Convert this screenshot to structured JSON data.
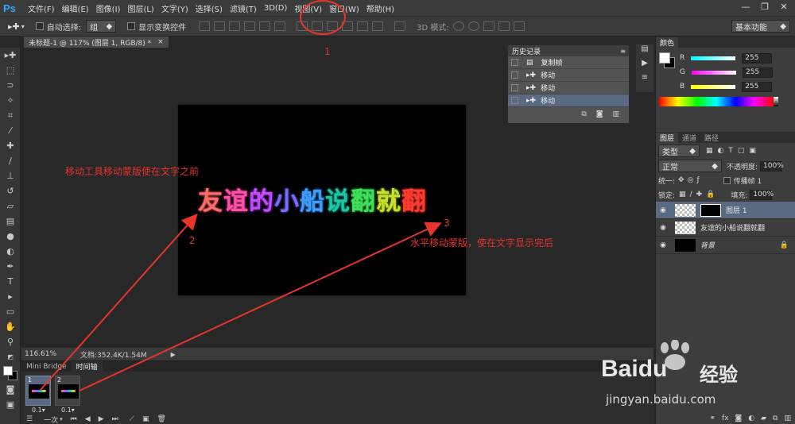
{
  "app": {
    "logo": "Ps"
  },
  "menu": [
    "文件(F)",
    "编辑(E)",
    "图像(I)",
    "图层(L)",
    "文字(Y)",
    "选择(S)",
    "滤镜(T)",
    "3D(D)",
    "视图(V)",
    "窗口(W)",
    "帮助(H)"
  ],
  "window_controls": [
    "—",
    "❐",
    "✕"
  ],
  "options": {
    "auto_select_label": "自动选择:",
    "auto_select_value": "组",
    "show_transform_label": "显示变换控件",
    "mode_3d_label": "3D 模式:",
    "workspace": "基本功能"
  },
  "document": {
    "tab_title": "未标题-1 @ 117% (图层 1, RGB/8) *",
    "zoom": "116.61%",
    "doc_size": "文档:352.4K/1.54M",
    "canvas_text_chars": [
      "友",
      "谊",
      "的",
      "小",
      "船",
      "说",
      "翻",
      "就",
      "翻"
    ],
    "canvas_text_colors": [
      "#ff6a6a",
      "#ff4fa8",
      "#c04bff",
      "#7a6bff",
      "#3f9cff",
      "#19c8a6",
      "#3ee05a",
      "#c6e22a",
      "#ff3b30"
    ]
  },
  "timeline": {
    "tabs": [
      "Mini Bridge",
      "时间轴"
    ],
    "frames": [
      {
        "num": "1",
        "delay": "0.1▾"
      },
      {
        "num": "2",
        "delay": "0.1▾"
      }
    ],
    "loop": "一次"
  },
  "history": {
    "title": "历史记录",
    "rows": [
      "复制帧",
      "移动",
      "移动",
      "移动"
    ]
  },
  "color": {
    "title": "颜色",
    "channels": [
      {
        "label": "R",
        "value": "255",
        "color": "#ff4d4d"
      },
      {
        "label": "G",
        "value": "255",
        "color": "#45e24a"
      },
      {
        "label": "B",
        "value": "255",
        "color": "#3f6dff"
      }
    ]
  },
  "layers": {
    "tabs": [
      "图层",
      "通道",
      "路径"
    ],
    "filter": "类型",
    "blend": "正常",
    "opacity_label": "不透明度:",
    "opacity": "100%",
    "unify_label": "统一:",
    "propagate_label": "传播帧 1",
    "lock_label": "锁定:",
    "fill_label": "填充:",
    "fill": "100%",
    "items": [
      {
        "name": "图层 1"
      },
      {
        "name": "友谊的小船说翻就翻"
      },
      {
        "name": "背景"
      }
    ]
  },
  "annotations": {
    "text1": "移动工具移动蒙版使在文字之前",
    "text2": "水平移动蒙版，使在文字显示完后",
    "num1": "1",
    "num2": "2",
    "num3": "3"
  },
  "watermark": {
    "brand": "Bai",
    "brand2": "du",
    "cn": "经验",
    "url": "jingyan.baidu.com"
  }
}
